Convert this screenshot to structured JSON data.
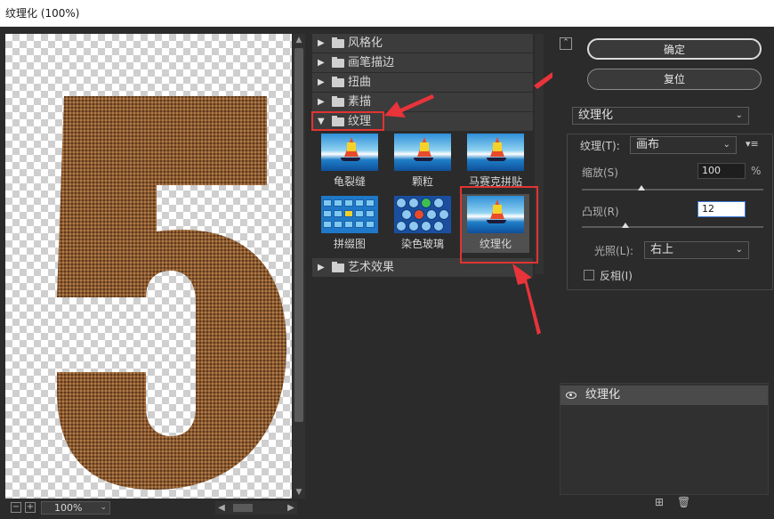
{
  "window": {
    "title": "纹理化 (100%)"
  },
  "preview": {
    "zoom": "100%"
  },
  "gallery": {
    "groups_top": [
      {
        "label": "风格化",
        "expanded": false
      },
      {
        "label": "画笔描边",
        "expanded": false
      },
      {
        "label": "扭曲",
        "expanded": false
      },
      {
        "label": "素描",
        "expanded": false
      }
    ],
    "open_group": {
      "label": "纹理",
      "expanded": true
    },
    "filters": [
      {
        "label": "龟裂缝"
      },
      {
        "label": "颗粒"
      },
      {
        "label": "马赛克拼贴"
      },
      {
        "label": "拼缀图"
      },
      {
        "label": "染色玻璃"
      },
      {
        "label": "纹理化",
        "selected": true
      }
    ],
    "group_after": {
      "label": "艺术效果",
      "expanded": false
    }
  },
  "panel": {
    "ok_label": "确定",
    "reset_label": "复位",
    "filter_select": "纹理化",
    "texture_label": "纹理(T):",
    "texture_value": "画布",
    "scaling_label": "缩放(S)",
    "scaling_value": "100",
    "scaling_unit": "%",
    "scaling_level": 0.33,
    "relief_label": "凸现(R)",
    "relief_value": "12",
    "relief_level": 0.24,
    "light_label": "光照(L):",
    "light_value": "右上",
    "invert_label": "反相(I)",
    "invert_checked": false
  },
  "layers": {
    "items": [
      {
        "label": "纹理化",
        "visible": true
      }
    ]
  },
  "colors": {
    "highlight": "#e23333",
    "texture": "#8a5a32",
    "annotation_arrow": "#e8343a"
  }
}
